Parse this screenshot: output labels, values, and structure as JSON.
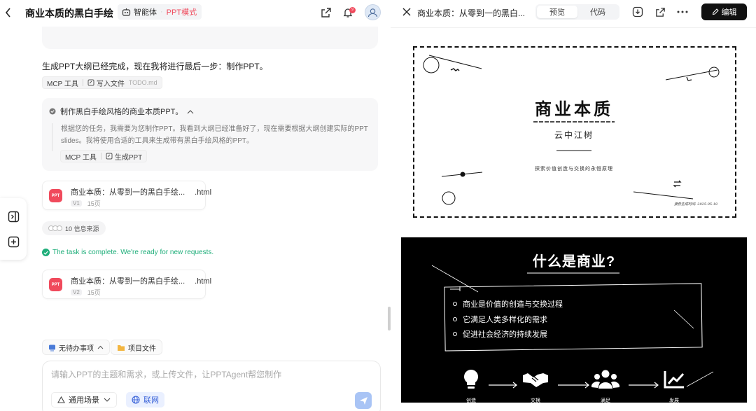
{
  "header": {
    "title": "商业本质的黑白手绘",
    "agent_label": "智能体",
    "mode_label": "PPT模式",
    "notification_count": "9"
  },
  "chat": {
    "message": "生成PPT大纲已经完成，现在我将进行最后一步：制作PPT。",
    "tool_chip_1": {
      "tool": "MCP 工具",
      "action": "写入文件",
      "file": "TODO.md"
    },
    "thinking": {
      "title": "制作黑白手绘风格的商业本质PPT。",
      "body": "根据您的任务，我需要为您制作PPT。我看到大纲已经准备好了，现在需要根据大纲创建实际的PPT slides。我将使用合适的工具来生成带有黑白手绘风格的PPT。",
      "tool": "MCP 工具",
      "action": "生成PPT"
    },
    "file_cards": [
      {
        "icon_text": "PPT",
        "name": "商业本质：从零到一的黑白手绘...",
        "ext": ".html",
        "version": "V1",
        "pages": "15页"
      },
      {
        "icon_text": "PPT",
        "name": "商业本质：从零到一的黑白手绘...",
        "ext": ".html",
        "version": "V2",
        "pages": "15页"
      }
    ],
    "sources": "10 信息来源",
    "status": "The task is complete. We're ready for new requests."
  },
  "bottom": {
    "todo_label": "无待办事项",
    "project_files_label": "项目文件",
    "input_placeholder": "请输入PPT的主题和需求，或上传文件，让PPTAgent帮您制作",
    "scene_label": "通用场景",
    "web_label": "联网"
  },
  "preview": {
    "title": "商业本质：从零到一的黑白...",
    "tabs": [
      "预览",
      "代码"
    ],
    "active_tab": "预览",
    "edit_label": "编辑",
    "slide1": {
      "title": "商业本质",
      "author": "云中江树",
      "subtitle": "探索价值创造与交换的永恒原理",
      "date": "报告生成时间: 2025-05-18"
    },
    "slide2": {
      "title": "什么是商业?",
      "bullets": [
        "商业是价值的创造与交换过程",
        "它满足人类多样化的需求",
        "促进社会经济的持续发展"
      ],
      "flow": [
        "创造",
        "交换",
        "满足",
        "发展"
      ]
    }
  },
  "colors": {
    "accent_red": "#f04a5c",
    "accent_green": "#1fae7a",
    "accent_blue": "#3a63d8"
  }
}
